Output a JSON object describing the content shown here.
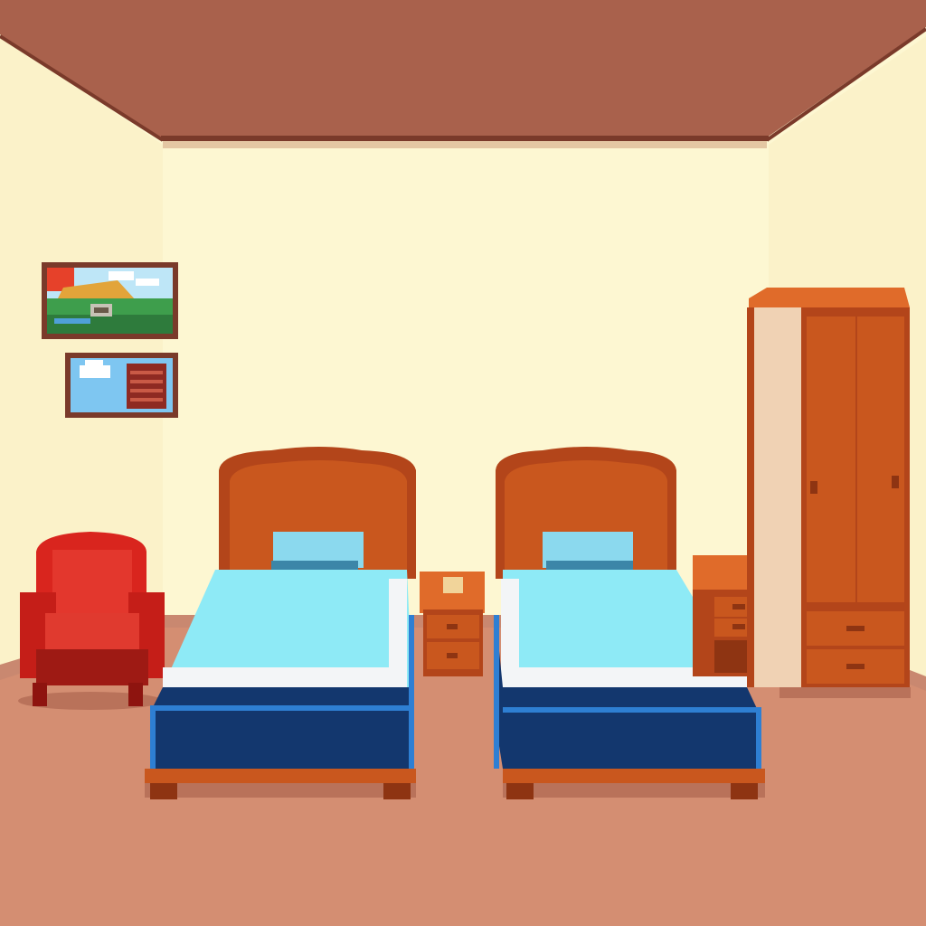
{
  "scene": {
    "kind": "pixel-art bedroom",
    "colors": {
      "ceiling": "#A9614C",
      "ceiling_edge": "#7A3A2A",
      "wall": "#FDF7D2",
      "wall_shadow": "#F3E7BC",
      "floor": "#D48E72",
      "floor_shadow": "#B9725A",
      "baseboard": "#C98870",
      "wood": "#C9571E",
      "wood_dark": "#8E3412",
      "wood_light": "#E06B2A",
      "sheet": "#8EEAF6",
      "sheet_white": "#F3F5F7",
      "bed_base": "#13376E",
      "bed_trim": "#2E7FD3",
      "pillow": "#8BD9EE",
      "pillow_dark": "#3C86A8",
      "armchair": "#D9251E",
      "armchair_dark": "#8E140F",
      "frame": "#7A3A2A"
    },
    "objects": {
      "ceiling": "ceiling",
      "back_wall": "wall",
      "floor": "floor",
      "landscape_painting": "landscape-painting",
      "sky_painting": "sky-painting",
      "armchair": "armchair",
      "left_bed": "bed",
      "right_bed": "bed",
      "center_nightstand": "nightstand",
      "right_nightstand": "nightstand",
      "wardrobe": "wardrobe",
      "doorknob_icon": "doorknob-icon"
    }
  }
}
